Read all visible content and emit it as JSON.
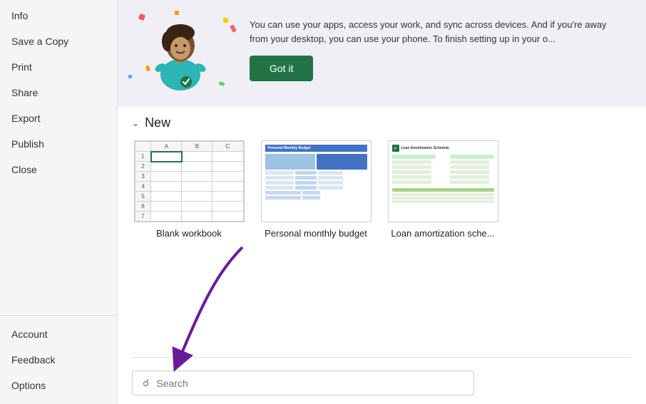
{
  "sidebar": {
    "top_items": [
      {
        "label": "Info",
        "id": "info"
      },
      {
        "label": "Save a Copy",
        "id": "save-a-copy"
      },
      {
        "label": "Print",
        "id": "print"
      },
      {
        "label": "Share",
        "id": "share"
      },
      {
        "label": "Export",
        "id": "export"
      },
      {
        "label": "Publish",
        "id": "publish"
      },
      {
        "label": "Close",
        "id": "close"
      }
    ],
    "bottom_items": [
      {
        "label": "Account",
        "id": "account"
      },
      {
        "label": "Feedback",
        "id": "feedback"
      },
      {
        "label": "Options",
        "id": "options"
      }
    ]
  },
  "notification": {
    "text": "You can use your apps, access your work, and sync across devices. And if you're away from your desktop, you can use your phone. To finish setting up in your o...",
    "button_label": "Got it"
  },
  "new_section": {
    "label": "New",
    "templates": [
      {
        "id": "blank-workbook",
        "label": "Blank workbook"
      },
      {
        "id": "personal-monthly-budget",
        "label": "Personal monthly budget"
      },
      {
        "id": "loan-amortization",
        "label": "Loan amortization sche..."
      }
    ]
  },
  "search": {
    "placeholder": "Search"
  },
  "colors": {
    "green_accent": "#217346",
    "sidebar_bg": "#f5f5f5",
    "banner_bg": "#f0eff5"
  }
}
